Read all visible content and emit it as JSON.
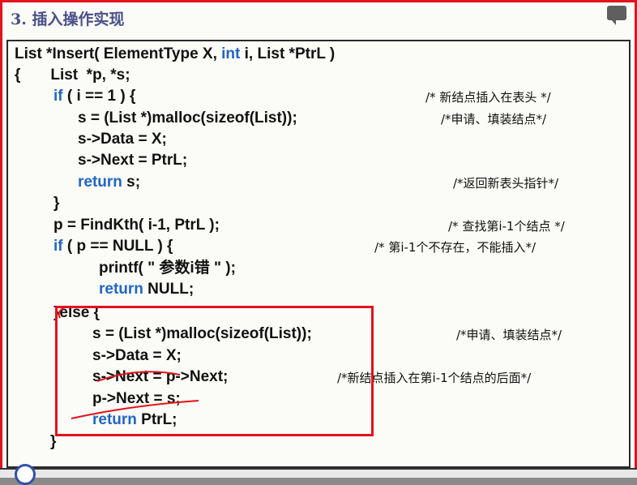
{
  "slide": {
    "heading": "3. 插入操作实现"
  },
  "code": [
    {
      "parts": [
        {
          "t": "List *Insert( ElementType X, "
        },
        {
          "t": "int",
          "kw": true
        },
        {
          "t": " i, List *PtrL )"
        }
      ],
      "comment": ""
    },
    {
      "parts": [
        {
          "t": "{       List  *p, *s;"
        }
      ],
      "comment": ""
    },
    {
      "parts": [
        {
          "t": "if",
          "kw": true
        },
        {
          "t": " ( i == 1 ) {"
        }
      ],
      "comment": "/* 新结点插入在表头 */"
    },
    {
      "parts": [
        {
          "t": "s = (List *)malloc(sizeof(List));"
        }
      ],
      "comment": "/*申请、填装结点*/"
    },
    {
      "parts": [
        {
          "t": "s->Data = X;"
        }
      ],
      "comment": ""
    },
    {
      "parts": [
        {
          "t": "s->Next = PtrL;"
        }
      ],
      "comment": ""
    },
    {
      "parts": [
        {
          "t": "return",
          "kw": true
        },
        {
          "t": " s;"
        }
      ],
      "comment": "/*返回新表头指针*/"
    },
    {
      "parts": [
        {
          "t": "}"
        }
      ],
      "comment": ""
    },
    {
      "parts": [
        {
          "t": "p = FindKth( i-1, PtrL );"
        }
      ],
      "comment": "/* 查找第i-1个结点 */"
    },
    {
      "parts": [
        {
          "t": "if",
          "kw": true
        },
        {
          "t": " ( p == NULL ) {"
        }
      ],
      "comment": "/* 第i-1个不存在，不能插入*/"
    },
    {
      "parts": [
        {
          "t": "printf( \" 参数i错 \" );"
        }
      ],
      "comment": ""
    },
    {
      "parts": [
        {
          "t": "return",
          "kw": true
        },
        {
          "t": " NULL;"
        }
      ],
      "comment": ""
    },
    {
      "parts": [
        {
          "t": "}else {"
        }
      ],
      "comment": ""
    },
    {
      "parts": [
        {
          "t": "s = (List *)malloc(sizeof(List));"
        }
      ],
      "comment": "/*申请、填装结点*/"
    },
    {
      "parts": [
        {
          "t": "s->Data = X;"
        }
      ],
      "comment": ""
    },
    {
      "parts": [
        {
          "t": "s->Next = p->Next;"
        }
      ],
      "comment": "/*新结点插入在第i-1个结点的后面*/"
    },
    {
      "parts": [
        {
          "t": "p->Next = s;"
        }
      ],
      "comment": ""
    },
    {
      "parts": [
        {
          "t": "return",
          "kw": true
        },
        {
          "t": " PtrL;"
        }
      ],
      "comment": ""
    },
    {
      "parts": [
        {
          "t": "}"
        }
      ],
      "comment": ""
    }
  ],
  "colors": {
    "keyword": "#1f66c8",
    "frame_border": "#e2131b",
    "highlight_box": "#e2131b",
    "heading": "#4a4f8a"
  }
}
